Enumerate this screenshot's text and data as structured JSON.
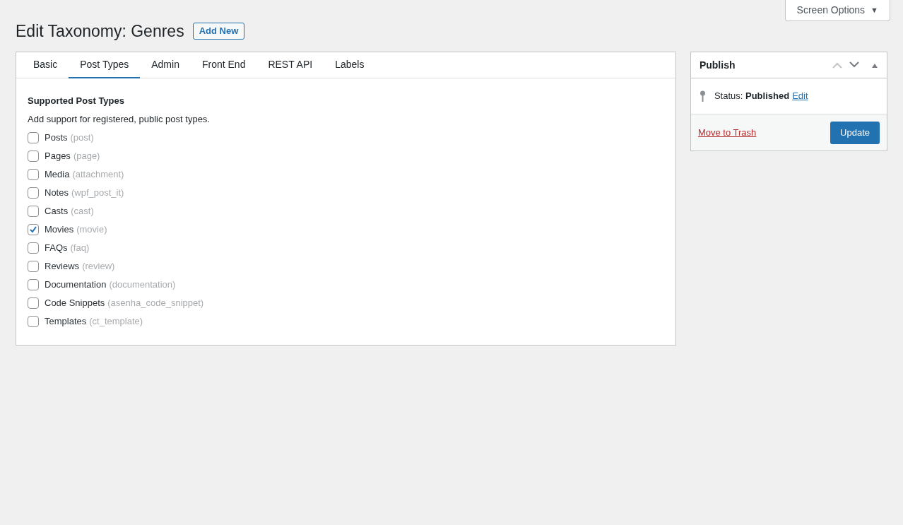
{
  "screen_options": {
    "label": "Screen Options",
    "arrow": "▼"
  },
  "page_title": "Edit Taxonomy: Genres",
  "add_new": "Add New",
  "tabs": [
    {
      "label": "Basic",
      "selected": false
    },
    {
      "label": "Post Types",
      "selected": true
    },
    {
      "label": "Admin",
      "selected": false
    },
    {
      "label": "Front End",
      "selected": false
    },
    {
      "label": "REST API",
      "selected": false
    },
    {
      "label": "Labels",
      "selected": false
    }
  ],
  "section": {
    "title": "Supported Post Types",
    "description": "Add support for registered, public post types."
  },
  "post_types": [
    {
      "label": "Posts",
      "slug": "(post)",
      "checked": false
    },
    {
      "label": "Pages",
      "slug": "(page)",
      "checked": false
    },
    {
      "label": "Media",
      "slug": "(attachment)",
      "checked": false
    },
    {
      "label": "Notes",
      "slug": "(wpf_post_it)",
      "checked": false
    },
    {
      "label": "Casts",
      "slug": "(cast)",
      "checked": false
    },
    {
      "label": "Movies",
      "slug": "(movie)",
      "checked": true
    },
    {
      "label": "FAQs",
      "slug": "(faq)",
      "checked": false
    },
    {
      "label": "Reviews",
      "slug": "(review)",
      "checked": false
    },
    {
      "label": "Documentation",
      "slug": "(documentation)",
      "checked": false
    },
    {
      "label": "Code Snippets",
      "slug": "(asenha_code_snippet)",
      "checked": false
    },
    {
      "label": "Templates",
      "slug": "(ct_template)",
      "checked": false
    }
  ],
  "publish": {
    "title": "Publish",
    "status_label": "Status:",
    "status": "Published",
    "edit": "Edit",
    "trash": "Move to Trash",
    "update": "Update"
  }
}
